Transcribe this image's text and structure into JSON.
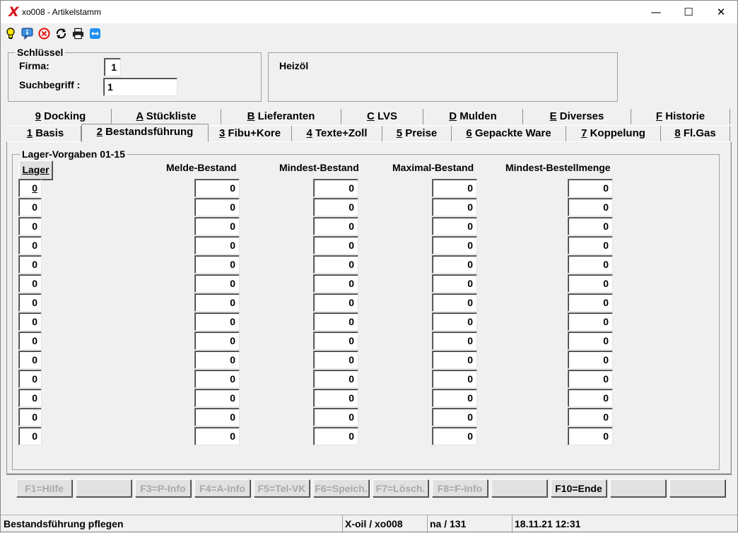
{
  "window": {
    "title": "xo008 - Artikelstamm",
    "app_icon_glyph": "X",
    "minimize": "—",
    "maximize": "☐",
    "close": "✕"
  },
  "toolbar": {
    "icons": [
      "lightbulb-icon",
      "info-message-icon",
      "cancel-icon",
      "refresh-icon",
      "printer-icon",
      "remote-support-icon"
    ]
  },
  "key": {
    "legend": "Schlüssel",
    "firma_label": "Firma:",
    "firma_value": "1",
    "suchbegriff_label": "Suchbegriff :",
    "suchbegriff_value": "1"
  },
  "description": "Heizöl",
  "tabs_back": [
    {
      "acc": "9",
      "rest": " Docking"
    },
    {
      "acc": "A",
      "rest": " Stückliste"
    },
    {
      "acc": "B",
      "rest": " Lieferanten"
    },
    {
      "acc": "C",
      "rest": " LVS"
    },
    {
      "acc": "D",
      "rest": " Mulden"
    },
    {
      "acc": "E",
      "rest": " Diverses"
    },
    {
      "acc": "F",
      "rest": " Historie"
    }
  ],
  "tabs_front": [
    {
      "acc": "1",
      "rest": " Basis"
    },
    {
      "acc": "2",
      "rest": " Bestandsführung",
      "active": true
    },
    {
      "acc": "3",
      "rest": " Fibu+Kore"
    },
    {
      "acc": "4",
      "rest": " Texte+Zoll"
    },
    {
      "acc": "5",
      "rest": " Preise"
    },
    {
      "acc": "6",
      "rest": " Gepackte Ware"
    },
    {
      "acc": "7",
      "rest": " Koppelung"
    },
    {
      "acc": "8",
      "rest": " Fl.Gas"
    }
  ],
  "lager_group": {
    "legend": "Lager-Vorgaben 01-15",
    "lager_button": "Lager",
    "columns": [
      "Melde-Bestand",
      "Mindest-Bestand",
      "Maximal-Bestand",
      "Mindest-Bestellmenge"
    ],
    "rows": [
      [
        "0",
        "0",
        "0",
        "0",
        "0"
      ],
      [
        "0",
        "0",
        "0",
        "0",
        "0"
      ],
      [
        "0",
        "0",
        "0",
        "0",
        "0"
      ],
      [
        "0",
        "0",
        "0",
        "0",
        "0"
      ],
      [
        "0",
        "0",
        "0",
        "0",
        "0"
      ],
      [
        "0",
        "0",
        "0",
        "0",
        "0"
      ],
      [
        "0",
        "0",
        "0",
        "0",
        "0"
      ],
      [
        "0",
        "0",
        "0",
        "0",
        "0"
      ],
      [
        "0",
        "0",
        "0",
        "0",
        "0"
      ],
      [
        "0",
        "0",
        "0",
        "0",
        "0"
      ],
      [
        "0",
        "0",
        "0",
        "0",
        "0"
      ],
      [
        "0",
        "0",
        "0",
        "0",
        "0"
      ],
      [
        "0",
        "0",
        "0",
        "0",
        "0"
      ],
      [
        "0",
        "0",
        "0",
        "0",
        "0"
      ]
    ]
  },
  "fkeys": [
    {
      "label": "F1=Hilfe",
      "enabled": false
    },
    {
      "label": "",
      "enabled": false
    },
    {
      "label": "F3=P-Info",
      "enabled": false
    },
    {
      "label": "F4=A-Info",
      "enabled": false
    },
    {
      "label": "F5=Tel-VK",
      "enabled": false
    },
    {
      "label": "F6=Speich.",
      "enabled": false
    },
    {
      "label": "F7=Lösch.",
      "enabled": false
    },
    {
      "label": "F8=F-Info",
      "enabled": false
    },
    {
      "label": "",
      "enabled": false
    },
    {
      "label": "F10=Ende",
      "enabled": true
    },
    {
      "label": "",
      "enabled": false
    },
    {
      "label": "",
      "enabled": false
    }
  ],
  "status": {
    "message": "Bestandsführung pflegen",
    "system": "X-oil / xo008",
    "user": "na / 131",
    "datetime": "18.11.21 12:31"
  }
}
